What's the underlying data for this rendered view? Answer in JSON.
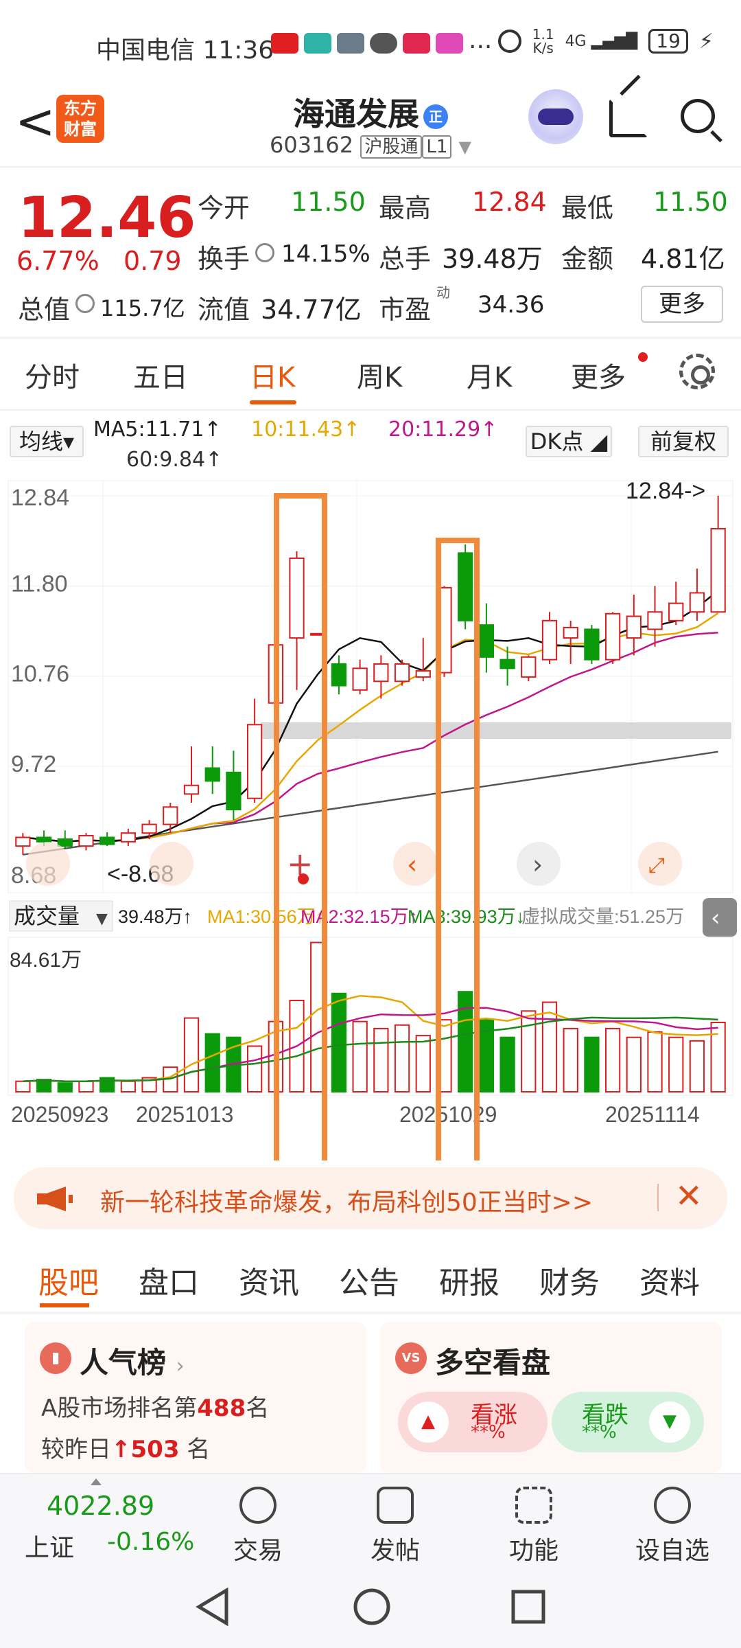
{
  "status": {
    "left": "中国电信 11:36",
    "speed": "1.1\nK/s",
    "signal": "4G",
    "battery": "19",
    "dots": "···"
  },
  "header": {
    "back": "<",
    "logo": "东方\n财富",
    "title": "海通发展",
    "badge": "正",
    "code": "603162",
    "tag1": "沪股通",
    "tag2": "L1"
  },
  "quote": {
    "price": "12.46",
    "pct": "6.77%",
    "chg": "0.79",
    "open_lbl": "今开",
    "open": "11.50",
    "high_lbl": "最高",
    "high": "12.84",
    "low_lbl": "最低",
    "low": "11.50",
    "turn_lbl": "换手",
    "turn": "14.15%",
    "vol_lbl": "总手",
    "vol": "39.48万",
    "amt_lbl": "金额",
    "amt": "4.81亿",
    "cap_lbl": "总值",
    "cap": "115.7亿",
    "float_lbl": "流值",
    "float": "34.77亿",
    "pe_lbl": "市盈",
    "pe_sup": "动",
    "pe": "34.36",
    "more": "更多"
  },
  "tabs": [
    "分时",
    "五日",
    "日K",
    "周K",
    "月K",
    "更多"
  ],
  "ma": {
    "sel": "均线",
    "ma5": "MA5:11.71↑",
    "ma10": "10:11.43↑",
    "ma20": "20:11.29↑",
    "ma60": "60:9.84↑",
    "dk": "DK点",
    "fq": "前复权"
  },
  "chart_data": {
    "type": "candlestick",
    "price_ticks": [
      "12.84",
      "11.80",
      "10.76",
      "9.72",
      "8.68"
    ],
    "max_label": "12.84->",
    "min_label": "<-8.68",
    "candles": [
      {
        "o": 8.8,
        "h": 8.95,
        "l": 8.7,
        "c": 8.9
      },
      {
        "o": 8.9,
        "h": 8.98,
        "l": 8.8,
        "c": 8.85
      },
      {
        "o": 8.88,
        "h": 8.98,
        "l": 8.78,
        "c": 8.8
      },
      {
        "o": 8.8,
        "h": 8.95,
        "l": 8.75,
        "c": 8.92
      },
      {
        "o": 8.9,
        "h": 8.96,
        "l": 8.8,
        "c": 8.82
      },
      {
        "o": 8.85,
        "h": 9.0,
        "l": 8.8,
        "c": 8.95
      },
      {
        "o": 8.95,
        "h": 9.1,
        "l": 8.88,
        "c": 9.05
      },
      {
        "o": 9.05,
        "h": 9.3,
        "l": 8.95,
        "c": 9.25
      },
      {
        "o": 9.4,
        "h": 9.95,
        "l": 9.3,
        "c": 9.5
      },
      {
        "o": 9.7,
        "h": 9.95,
        "l": 9.4,
        "c": 9.55
      },
      {
        "o": 9.65,
        "h": 9.9,
        "l": 9.1,
        "c": 9.22
      },
      {
        "o": 9.35,
        "h": 10.5,
        "l": 9.3,
        "c": 10.2
      },
      {
        "o": 10.45,
        "h": 11.15,
        "l": 10.4,
        "c": 11.12
      },
      {
        "o": 11.2,
        "h": 12.2,
        "l": 10.6,
        "c": 12.12
      },
      {
        "o": 11.25,
        "h": 11.25,
        "l": 11.25,
        "c": 11.25
      },
      {
        "o": 10.9,
        "h": 11.0,
        "l": 10.55,
        "c": 10.65
      },
      {
        "o": 10.6,
        "h": 10.95,
        "l": 10.55,
        "c": 10.85
      },
      {
        "o": 10.7,
        "h": 11.0,
        "l": 10.5,
        "c": 10.9
      },
      {
        "o": 10.7,
        "h": 10.95,
        "l": 10.65,
        "c": 10.9
      },
      {
        "o": 10.75,
        "h": 11.2,
        "l": 10.7,
        "c": 10.82
      },
      {
        "o": 10.8,
        "h": 11.8,
        "l": 10.75,
        "c": 11.78
      },
      {
        "o": 12.18,
        "h": 12.28,
        "l": 11.3,
        "c": 11.4
      },
      {
        "o": 11.35,
        "h": 11.6,
        "l": 10.8,
        "c": 10.98
      },
      {
        "o": 10.95,
        "h": 11.1,
        "l": 10.65,
        "c": 10.85
      },
      {
        "o": 10.75,
        "h": 11.0,
        "l": 10.7,
        "c": 10.98
      },
      {
        "o": 10.95,
        "h": 11.5,
        "l": 10.9,
        "c": 11.4
      },
      {
        "o": 11.2,
        "h": 11.4,
        "l": 10.9,
        "c": 11.32
      },
      {
        "o": 11.3,
        "h": 11.35,
        "l": 10.9,
        "c": 10.95
      },
      {
        "o": 10.95,
        "h": 11.5,
        "l": 10.9,
        "c": 11.48
      },
      {
        "o": 11.2,
        "h": 11.7,
        "l": 11.0,
        "c": 11.45
      },
      {
        "o": 11.3,
        "h": 11.8,
        "l": 11.1,
        "c": 11.5
      },
      {
        "o": 11.4,
        "h": 11.85,
        "l": 11.35,
        "c": 11.6
      },
      {
        "o": 11.5,
        "h": 12.0,
        "l": 11.4,
        "c": 11.72
      },
      {
        "o": 11.5,
        "h": 12.84,
        "l": 11.5,
        "c": 12.46
      }
    ],
    "vol_title": "成交量",
    "vol_info": {
      "v": "39.48万↑",
      "ma1": "MA1:30.56万↑",
      "ma2": "MA2:32.15万↑",
      "ma3": "MA3:39.93万↓",
      "virt": "虚拟成交量:51.25万"
    },
    "vol_max_label": "84.61万",
    "volumes": [
      6,
      7,
      5,
      6,
      8,
      6,
      8,
      14,
      42,
      33,
      31,
      26,
      40,
      52,
      85,
      56,
      40,
      36,
      38,
      32,
      41,
      57,
      41,
      31,
      46,
      51,
      36,
      31,
      36,
      31,
      34,
      31,
      29,
      39.48
    ],
    "dates": [
      "20250923",
      "20251013",
      "20251029",
      "20251114"
    ]
  },
  "banner": {
    "text": "新一轮科技革命爆发，布局科创50正当时>>",
    "close": "✕"
  },
  "sections": [
    "股吧",
    "盘口",
    "资讯",
    "公告",
    "研报",
    "财务",
    "资料"
  ],
  "rank": {
    "title": "人气榜",
    "line1a": "A股市场排名第",
    "line1b": "488",
    "line1c": "名",
    "line2a": "较昨日",
    "line2b": "503",
    "line2c": "名"
  },
  "bull": {
    "title": "多空看盘",
    "up": "看涨",
    "down": "看跌",
    "stars": "**%"
  },
  "bottom": {
    "index_val": "4022.89",
    "index_name": "上证",
    "index_chg": "-0.16%",
    "items": [
      "交易",
      "发帖",
      "功能",
      "设自选"
    ]
  }
}
